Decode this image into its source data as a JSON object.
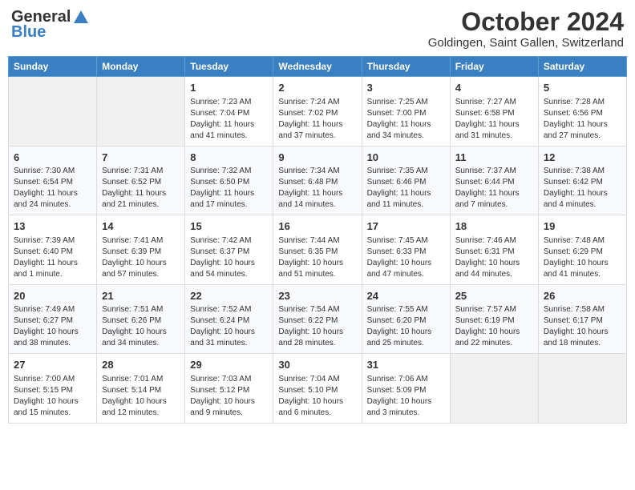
{
  "header": {
    "logo_general": "General",
    "logo_blue": "Blue",
    "month": "October 2024",
    "location": "Goldingen, Saint Gallen, Switzerland"
  },
  "days_of_week": [
    "Sunday",
    "Monday",
    "Tuesday",
    "Wednesday",
    "Thursday",
    "Friday",
    "Saturday"
  ],
  "weeks": [
    [
      {
        "day": "",
        "sunrise": "",
        "sunset": "",
        "daylight": ""
      },
      {
        "day": "",
        "sunrise": "",
        "sunset": "",
        "daylight": ""
      },
      {
        "day": "1",
        "sunrise": "Sunrise: 7:23 AM",
        "sunset": "Sunset: 7:04 PM",
        "daylight": "Daylight: 11 hours and 41 minutes."
      },
      {
        "day": "2",
        "sunrise": "Sunrise: 7:24 AM",
        "sunset": "Sunset: 7:02 PM",
        "daylight": "Daylight: 11 hours and 37 minutes."
      },
      {
        "day": "3",
        "sunrise": "Sunrise: 7:25 AM",
        "sunset": "Sunset: 7:00 PM",
        "daylight": "Daylight: 11 hours and 34 minutes."
      },
      {
        "day": "4",
        "sunrise": "Sunrise: 7:27 AM",
        "sunset": "Sunset: 6:58 PM",
        "daylight": "Daylight: 11 hours and 31 minutes."
      },
      {
        "day": "5",
        "sunrise": "Sunrise: 7:28 AM",
        "sunset": "Sunset: 6:56 PM",
        "daylight": "Daylight: 11 hours and 27 minutes."
      }
    ],
    [
      {
        "day": "6",
        "sunrise": "Sunrise: 7:30 AM",
        "sunset": "Sunset: 6:54 PM",
        "daylight": "Daylight: 11 hours and 24 minutes."
      },
      {
        "day": "7",
        "sunrise": "Sunrise: 7:31 AM",
        "sunset": "Sunset: 6:52 PM",
        "daylight": "Daylight: 11 hours and 21 minutes."
      },
      {
        "day": "8",
        "sunrise": "Sunrise: 7:32 AM",
        "sunset": "Sunset: 6:50 PM",
        "daylight": "Daylight: 11 hours and 17 minutes."
      },
      {
        "day": "9",
        "sunrise": "Sunrise: 7:34 AM",
        "sunset": "Sunset: 6:48 PM",
        "daylight": "Daylight: 11 hours and 14 minutes."
      },
      {
        "day": "10",
        "sunrise": "Sunrise: 7:35 AM",
        "sunset": "Sunset: 6:46 PM",
        "daylight": "Daylight: 11 hours and 11 minutes."
      },
      {
        "day": "11",
        "sunrise": "Sunrise: 7:37 AM",
        "sunset": "Sunset: 6:44 PM",
        "daylight": "Daylight: 11 hours and 7 minutes."
      },
      {
        "day": "12",
        "sunrise": "Sunrise: 7:38 AM",
        "sunset": "Sunset: 6:42 PM",
        "daylight": "Daylight: 11 hours and 4 minutes."
      }
    ],
    [
      {
        "day": "13",
        "sunrise": "Sunrise: 7:39 AM",
        "sunset": "Sunset: 6:40 PM",
        "daylight": "Daylight: 11 hours and 1 minute."
      },
      {
        "day": "14",
        "sunrise": "Sunrise: 7:41 AM",
        "sunset": "Sunset: 6:39 PM",
        "daylight": "Daylight: 10 hours and 57 minutes."
      },
      {
        "day": "15",
        "sunrise": "Sunrise: 7:42 AM",
        "sunset": "Sunset: 6:37 PM",
        "daylight": "Daylight: 10 hours and 54 minutes."
      },
      {
        "day": "16",
        "sunrise": "Sunrise: 7:44 AM",
        "sunset": "Sunset: 6:35 PM",
        "daylight": "Daylight: 10 hours and 51 minutes."
      },
      {
        "day": "17",
        "sunrise": "Sunrise: 7:45 AM",
        "sunset": "Sunset: 6:33 PM",
        "daylight": "Daylight: 10 hours and 47 minutes."
      },
      {
        "day": "18",
        "sunrise": "Sunrise: 7:46 AM",
        "sunset": "Sunset: 6:31 PM",
        "daylight": "Daylight: 10 hours and 44 minutes."
      },
      {
        "day": "19",
        "sunrise": "Sunrise: 7:48 AM",
        "sunset": "Sunset: 6:29 PM",
        "daylight": "Daylight: 10 hours and 41 minutes."
      }
    ],
    [
      {
        "day": "20",
        "sunrise": "Sunrise: 7:49 AM",
        "sunset": "Sunset: 6:27 PM",
        "daylight": "Daylight: 10 hours and 38 minutes."
      },
      {
        "day": "21",
        "sunrise": "Sunrise: 7:51 AM",
        "sunset": "Sunset: 6:26 PM",
        "daylight": "Daylight: 10 hours and 34 minutes."
      },
      {
        "day": "22",
        "sunrise": "Sunrise: 7:52 AM",
        "sunset": "Sunset: 6:24 PM",
        "daylight": "Daylight: 10 hours and 31 minutes."
      },
      {
        "day": "23",
        "sunrise": "Sunrise: 7:54 AM",
        "sunset": "Sunset: 6:22 PM",
        "daylight": "Daylight: 10 hours and 28 minutes."
      },
      {
        "day": "24",
        "sunrise": "Sunrise: 7:55 AM",
        "sunset": "Sunset: 6:20 PM",
        "daylight": "Daylight: 10 hours and 25 minutes."
      },
      {
        "day": "25",
        "sunrise": "Sunrise: 7:57 AM",
        "sunset": "Sunset: 6:19 PM",
        "daylight": "Daylight: 10 hours and 22 minutes."
      },
      {
        "day": "26",
        "sunrise": "Sunrise: 7:58 AM",
        "sunset": "Sunset: 6:17 PM",
        "daylight": "Daylight: 10 hours and 18 minutes."
      }
    ],
    [
      {
        "day": "27",
        "sunrise": "Sunrise: 7:00 AM",
        "sunset": "Sunset: 5:15 PM",
        "daylight": "Daylight: 10 hours and 15 minutes."
      },
      {
        "day": "28",
        "sunrise": "Sunrise: 7:01 AM",
        "sunset": "Sunset: 5:14 PM",
        "daylight": "Daylight: 10 hours and 12 minutes."
      },
      {
        "day": "29",
        "sunrise": "Sunrise: 7:03 AM",
        "sunset": "Sunset: 5:12 PM",
        "daylight": "Daylight: 10 hours and 9 minutes."
      },
      {
        "day": "30",
        "sunrise": "Sunrise: 7:04 AM",
        "sunset": "Sunset: 5:10 PM",
        "daylight": "Daylight: 10 hours and 6 minutes."
      },
      {
        "day": "31",
        "sunrise": "Sunrise: 7:06 AM",
        "sunset": "Sunset: 5:09 PM",
        "daylight": "Daylight: 10 hours and 3 minutes."
      },
      {
        "day": "",
        "sunrise": "",
        "sunset": "",
        "daylight": ""
      },
      {
        "day": "",
        "sunrise": "",
        "sunset": "",
        "daylight": ""
      }
    ]
  ]
}
